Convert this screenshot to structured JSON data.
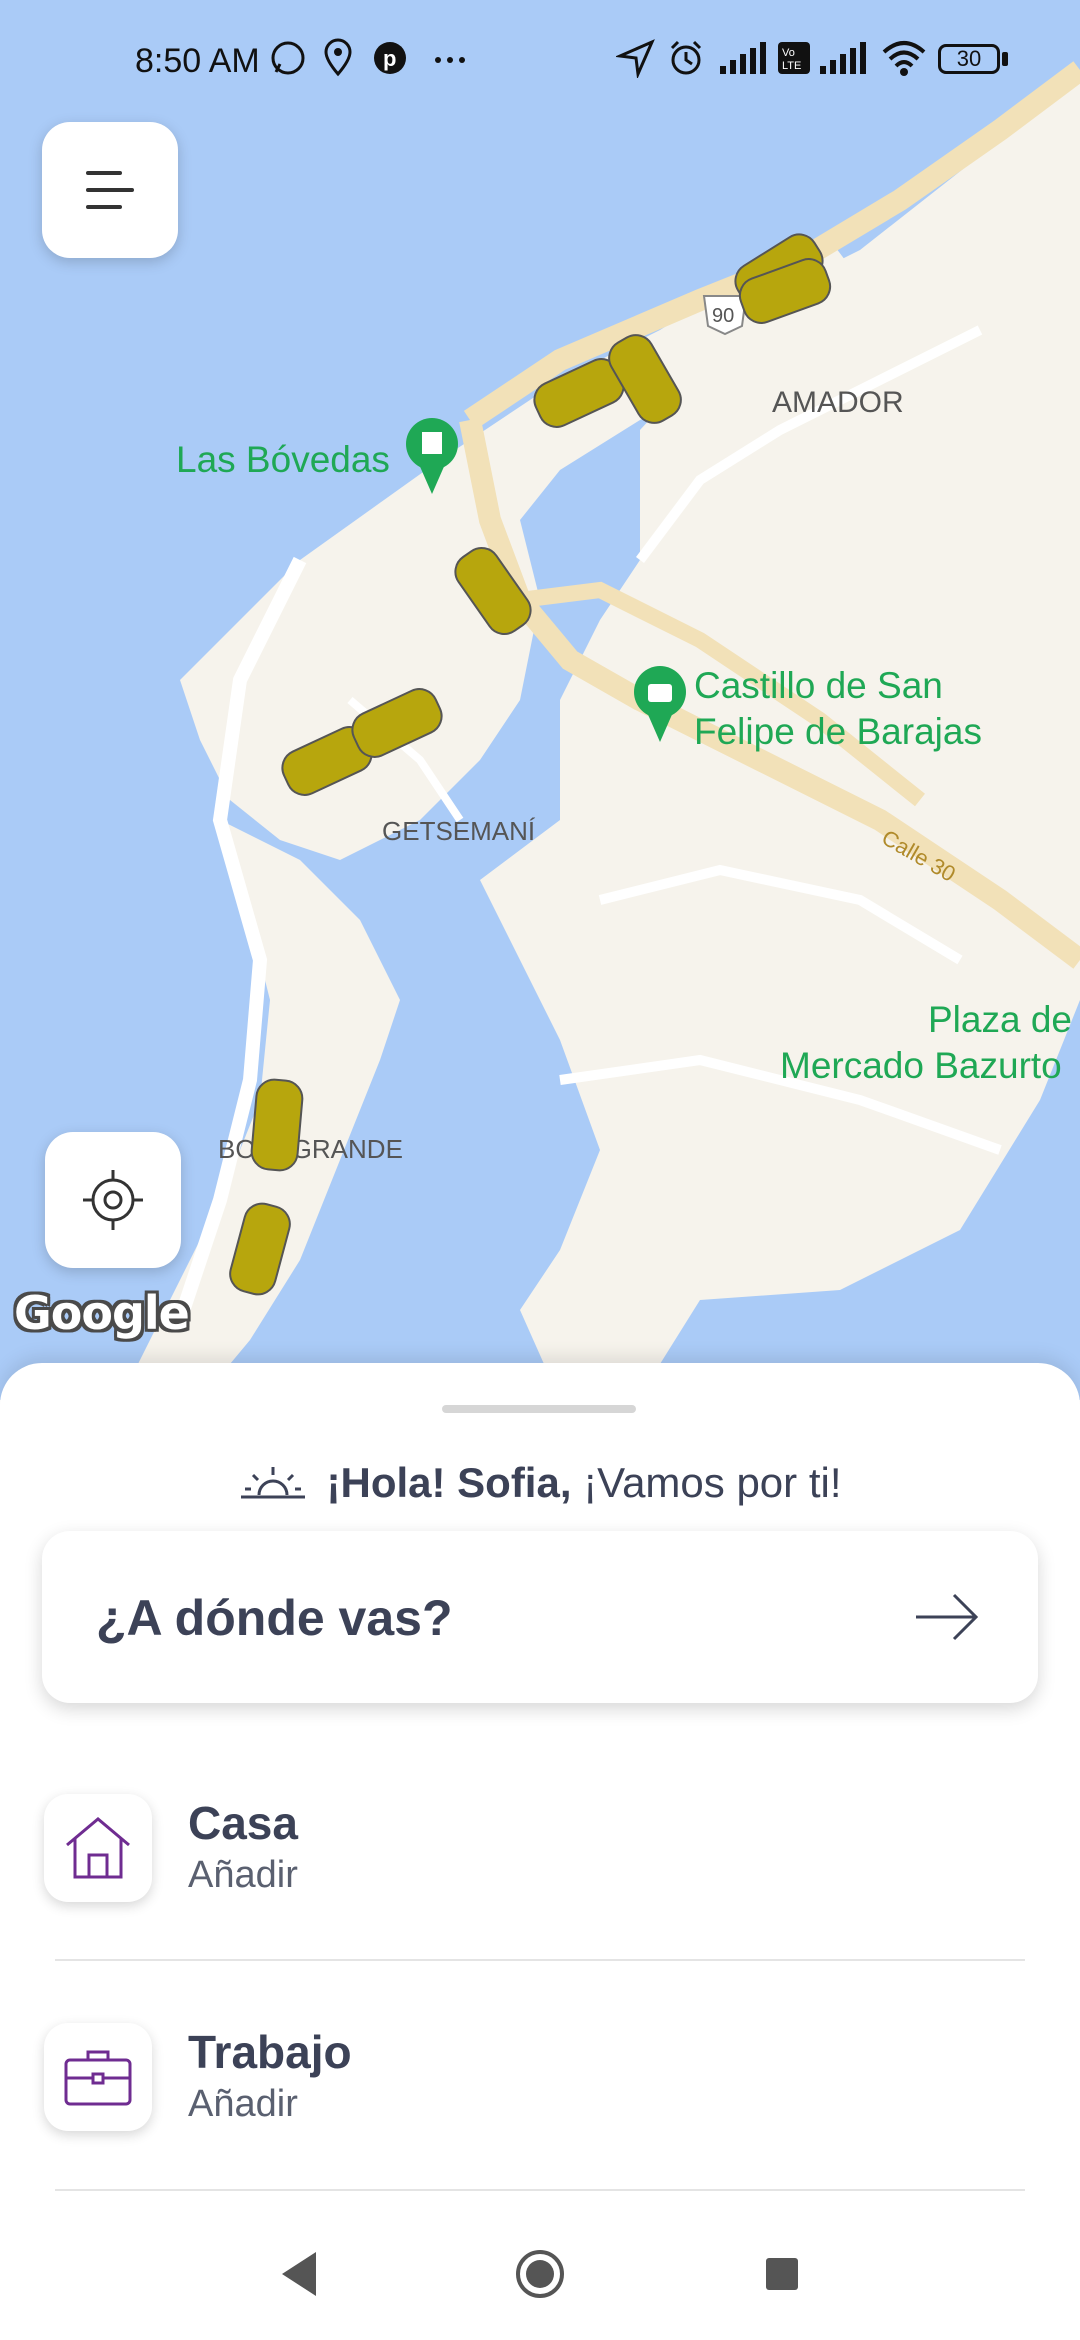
{
  "status_bar": {
    "time": "8:50 AM",
    "battery": "30",
    "left_icons": [
      "whatsapp-icon",
      "location-pin-icon",
      "pinterest-icon",
      "more-dots-icon"
    ],
    "right_icons": [
      "navigation-icon",
      "alarm-icon",
      "signal-icon",
      "volte-icon",
      "signal-icon",
      "wifi-icon",
      "battery-icon"
    ]
  },
  "map": {
    "labels": {
      "las_bovedas": "Las Bóvedas",
      "amador": "AMADOR",
      "castillo_line1": "Castillo de San",
      "castillo_line2": "Felipe de Barajas",
      "getsemani": "GETSEMANÍ",
      "calle30": "Calle 30",
      "plaza_line1": "Plaza de",
      "plaza_line2": "Mercado Bazurto",
      "bocagrande": "BOCAGRANDE",
      "route": "90"
    },
    "google_logo": "Google",
    "colors": {
      "water": "#aacbf7",
      "land": "#f6f3ec",
      "road": "#f2e1b8",
      "poi": "#1fa855",
      "taxi": "#b7a60d"
    }
  },
  "sheet": {
    "greeting_bold": "¡Hola! Sofia,",
    "greeting_rest": "¡Vamos por ti!",
    "destination_label": "¿A dónde vas?",
    "places": [
      {
        "title": "Casa",
        "subtitle": "Añadir",
        "icon": "home-icon"
      },
      {
        "title": "Trabajo",
        "subtitle": "Añadir",
        "icon": "briefcase-icon"
      }
    ],
    "accent_color": "#6f2c91"
  },
  "nav_bar": {
    "buttons": [
      "back-icon",
      "home-circle-icon",
      "recents-square-icon"
    ]
  }
}
